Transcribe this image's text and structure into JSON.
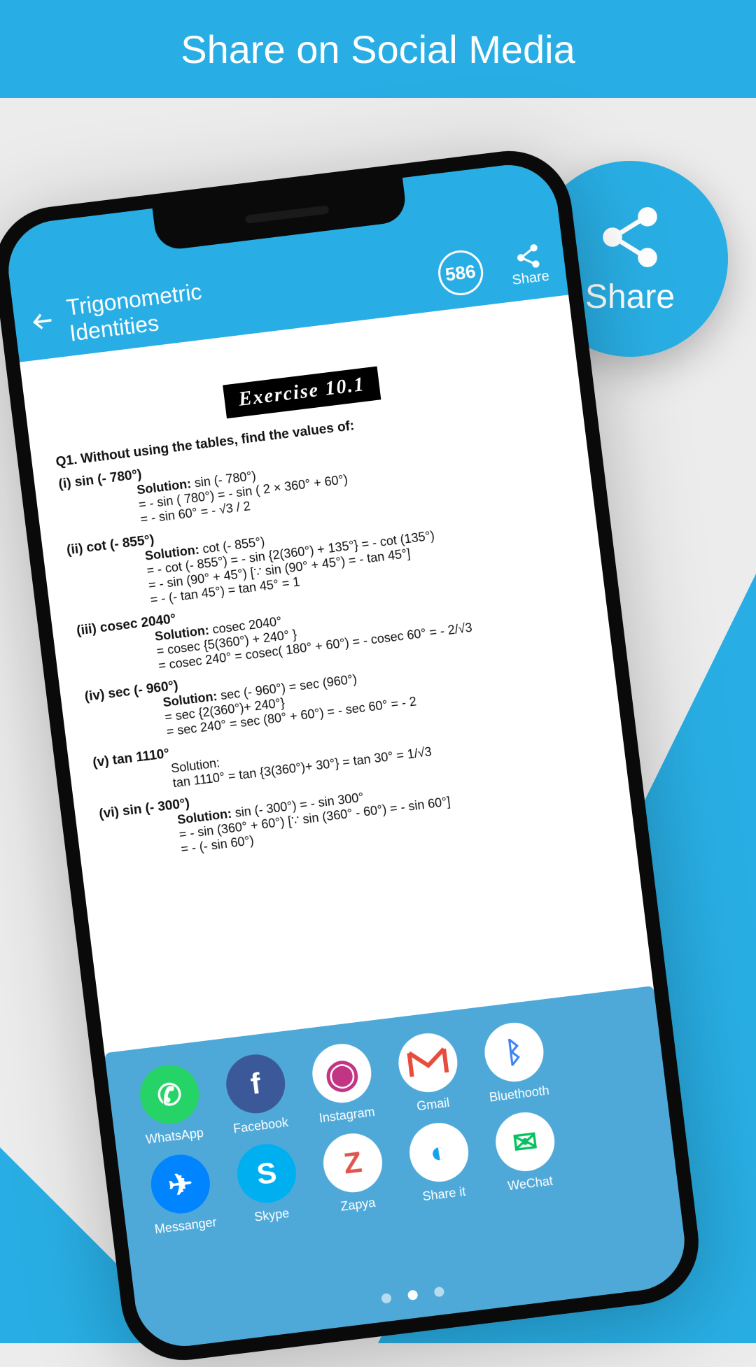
{
  "banner": {
    "text": "Share on Social Media"
  },
  "callout": {
    "label": "Share"
  },
  "appbar": {
    "title_line1": "Trigonometric",
    "title_line2": "Identities",
    "badge": "586",
    "share_label": "Share"
  },
  "doc": {
    "exercise_title": "Exercise   10.1",
    "q": "Q1.   Without using the tables, find the values of:",
    "parts": [
      {
        "label": "(i)   sin (- 780°)",
        "steps": [
          "sin (- 780°)",
          "= - sin ( 780°) = - sin ( 2 × 360° + 60°)",
          "= - sin 60°  =  - √3 / 2"
        ]
      },
      {
        "label": "(ii)   cot (- 855°)",
        "steps": [
          "cot (- 855°)",
          "= - cot (- 855°) = - sin {2(360°) + 135°} = - cot (135°)",
          "= - sin (90° + 45°)   [∵ sin (90° + 45°) = - tan 45°]",
          "= - (- tan 45°) = tan 45° = 1"
        ]
      },
      {
        "label": "(iii)   cosec 2040°",
        "steps": [
          "cosec 2040°",
          "= cosec {5(360°) + 240° }",
          "= cosec 240° = cosec( 180° + 60°) = - cosec 60° = - 2/√3"
        ]
      },
      {
        "label": "(iv)   sec (- 960°)",
        "steps": [
          "sec (- 960°) = sec (960°)",
          "= sec {2(360°)+ 240°}",
          "= sec 240° = sec (80° + 60°) = - sec 60° = - 2"
        ]
      },
      {
        "label": "(v)   tan 1110°",
        "steps": [
          "Solution:",
          "tan 1110° = tan {3(360°)+ 30°} = tan 30° = 1/√3"
        ]
      },
      {
        "label": "(vi)   sin (- 300°)",
        "steps": [
          "sin (- 300°) = - sin 300°",
          "= - sin (360° + 60°)      [∵ sin (360° - 60°) = - sin 60°]",
          "= - (- sin 60°)"
        ]
      }
    ]
  },
  "share_sheet": {
    "apps": [
      {
        "key": "WhatsApp"
      },
      {
        "key": "Facebook"
      },
      {
        "key": "Instagram"
      },
      {
        "key": "Gmail"
      },
      {
        "key": "Bluethooth"
      },
      {
        "key": "Messanger"
      },
      {
        "key": "Skype"
      },
      {
        "key": "Zapya"
      },
      {
        "key": "Share it"
      },
      {
        "key": "WeChat"
      }
    ],
    "page_count": 3,
    "active_page": 1
  }
}
